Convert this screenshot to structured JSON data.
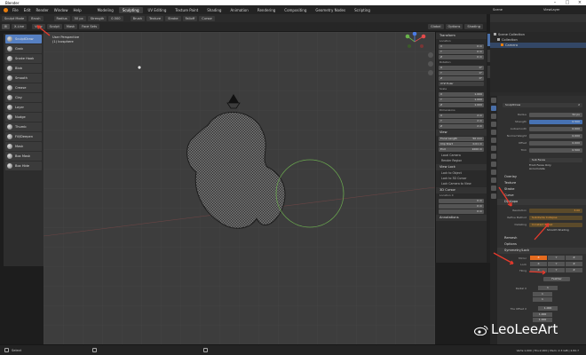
{
  "app": {
    "title": "Blender"
  },
  "menu": {
    "items": [
      "File",
      "Edit",
      "Render",
      "Window",
      "Help"
    ],
    "workspaces": [
      "Modeling",
      "Sculpting",
      "UV Editing",
      "Texture Paint",
      "Shading",
      "Animation",
      "Rendering",
      "Compositing",
      "Geometry Nodes",
      "Scripting"
    ],
    "active_workspace": "Sculpting",
    "scene": "Scene",
    "view_layer": "ViewLayer"
  },
  "header": {
    "mode": "Sculpt Mode",
    "menus": [
      "View",
      "Sculpt",
      "Mask",
      "Face Sets"
    ],
    "brush_label": "Brush",
    "radius_label": "Radius",
    "radius_value": "50 px",
    "strength_label": "Strength",
    "strength_value": "0.500",
    "options": [
      "Brush",
      "Texture",
      "Stroke",
      "Falloff",
      "Cursor"
    ],
    "tool_label": "X-Line",
    "orientation": "Global",
    "overlay_menus": [
      "Options",
      "Shading"
    ]
  },
  "tools": [
    {
      "label": "SculptDraw",
      "active": true
    },
    {
      "label": "Grab",
      "active": false
    },
    {
      "label": "Snake Hook",
      "active": false
    },
    {
      "label": "Blob",
      "active": false
    },
    {
      "label": "Smooth",
      "active": false
    },
    {
      "label": "Crease",
      "active": false
    },
    {
      "label": "Clay",
      "active": false
    },
    {
      "label": "Layer",
      "active": false
    },
    {
      "label": "Nudge",
      "active": false
    },
    {
      "label": "Thumb",
      "active": false
    },
    {
      "label": "Fill/Deepen",
      "active": false
    },
    {
      "label": "Mask",
      "active": false
    },
    {
      "label": "Box Mask",
      "active": false
    },
    {
      "label": "Box Hide",
      "active": false
    }
  ],
  "viewport_info": {
    "line1": "User Perspective",
    "line2": "(1) Icosphere"
  },
  "npanel": {
    "transform_title": "Transform",
    "location_label": "Location",
    "location": [
      {
        "axis": "X",
        "value": "0 m"
      },
      {
        "axis": "Y",
        "value": "0 m"
      },
      {
        "axis": "Z",
        "value": "0 m"
      }
    ],
    "rotation_label": "Rotation",
    "rotation": [
      {
        "axis": "X",
        "value": "0°"
      },
      {
        "axis": "Y",
        "value": "0°"
      },
      {
        "axis": "Z",
        "value": "0°"
      }
    ],
    "rotation_mode": "XYZ Euler",
    "scale_label": "Scale",
    "scale": [
      {
        "axis": "X",
        "value": "1.000"
      },
      {
        "axis": "Y",
        "value": "1.000"
      },
      {
        "axis": "Z",
        "value": "1.000"
      }
    ],
    "dimensions_label": "Dimensions",
    "dimensions": [
      {
        "axis": "X",
        "value": "2 m"
      },
      {
        "axis": "Y",
        "value": "2 m"
      },
      {
        "axis": "Z",
        "value": "2 m"
      }
    ],
    "view_title": "View",
    "focal_length_label": "Focal Length",
    "focal_length": "50 mm",
    "clip_start_label": "Clip Start",
    "clip_start": "0.01 m",
    "clip_end_label": "End",
    "clip_end": "1000 m",
    "local_camera_label": "Local Camera",
    "render_region_label": "Render Region",
    "view_lock_title": "View Lock",
    "lock_to_object_label": "Lock to Object",
    "lock_to_cursor_label": "Lock to 3D Cursor",
    "lock_camera_label": "Lock Camera to View",
    "cursor_title": "3D Cursor",
    "cursor_location_label": "Location X",
    "cursor_location": [
      "0 m",
      "0 m",
      "0 m"
    ],
    "annotations_title": "Annotations"
  },
  "outliner": {
    "items": [
      "Scene Collection",
      "Collection",
      "Camera"
    ]
  },
  "properties": {
    "brush_name": "SculptDraw",
    "brush_users": "2",
    "radius_label": "Radius",
    "radius": "50 px",
    "strength_label": "Strength",
    "strength": "0.500",
    "autosmooth_label": "Autosmooth",
    "autosmooth": "0.000",
    "normal_weight_label": "Normal Weight",
    "normal_weight": "0.000",
    "plane_offset_label": "Offset",
    "plane_offset": "0.000",
    "plane_trim_label": "Trim",
    "plane_trim": "0.500",
    "direction": "Sub Faces",
    "front_faces_label": "Front Faces Only",
    "accumulate_label": "Accumulate",
    "sections": [
      "Overlay",
      "Texture",
      "Stroke",
      "Curve",
      "Dyntopo"
    ],
    "detail_size_label": "Resolution",
    "detail_size": "3.00",
    "refine_method_label": "Refine Method",
    "refine_method": "Subdivide Collapse",
    "detailing_label": "Detailing",
    "detailing": "Constant Detail",
    "smooth_shading_label": "Smooth Shading",
    "remesh_title": "Remesh",
    "options_title": "Options",
    "symmetry_title": "Symmetry/Lock",
    "mirror_label": "Mirror",
    "lock_label": "Lock",
    "tiling_label": "Tiling",
    "axes": [
      "X",
      "Y",
      "Z"
    ],
    "feather_label": "Feather",
    "radial_label": "Radial X",
    "radial_values": [
      "1",
      "1",
      "1"
    ],
    "tile_offset_label": "Tile Offset X",
    "tile_offset_values": [
      "1.000",
      "1.000",
      "1.000"
    ]
  },
  "status": {
    "select_label": "Select",
    "version": "Verts:1,000 | Tris:2,000 | Mem: 2.3 GiB | 2.82.7"
  },
  "watermark": "LeoLeeArt",
  "colors": {
    "accent": "#4772b3",
    "annotation": "#e83a2c",
    "active_axis": "#e56b1f"
  }
}
